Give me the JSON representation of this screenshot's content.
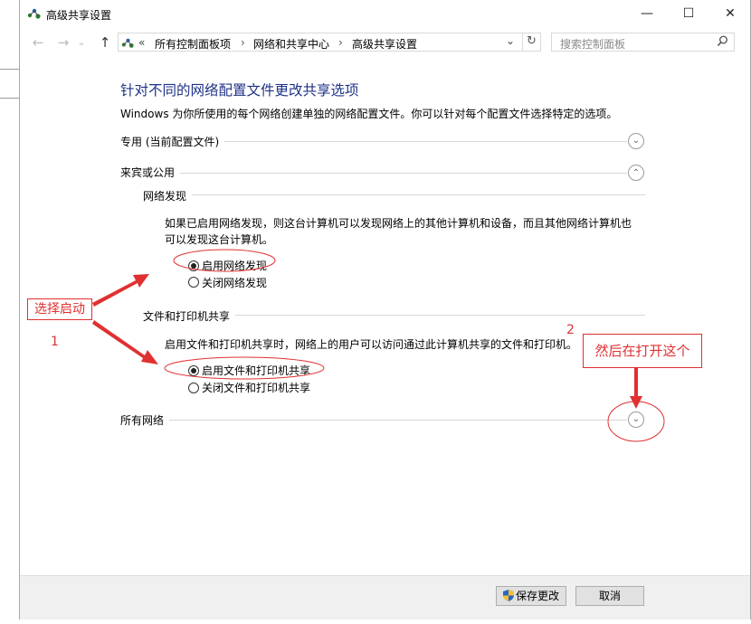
{
  "window": {
    "title": "高级共享设置",
    "minimize_glyph": "—",
    "maximize_glyph": "☐",
    "close_glyph": "✕"
  },
  "nav": {
    "back_glyph": "←",
    "forward_glyph": "→",
    "recent_glyph": "⌄",
    "up_glyph": "↑",
    "chevrons": "«",
    "breadcrumb": [
      "所有控制面板项",
      "网络和共享中心",
      "高级共享设置"
    ],
    "separator": "›",
    "dropdown_glyph": "⌄",
    "refresh_glyph": "↻",
    "search_placeholder": "搜索控制面板"
  },
  "main": {
    "heading": "针对不同的网络配置文件更改共享选项",
    "description": "Windows 为你所使用的每个网络创建单独的网络配置文件。你可以针对每个配置文件选择特定的选项。",
    "profiles": {
      "private": {
        "label": "专用 (当前配置文件)",
        "state": "collapsed"
      },
      "guest_public": {
        "label": "来宾或公用",
        "state": "expanded"
      },
      "all_networks": {
        "label": "所有网络",
        "state": "collapsed"
      }
    },
    "network_discovery": {
      "title": "网络发现",
      "description": "如果已启用网络发现，则这台计算机可以发现网络上的其他计算机和设备，而且其他网络计算机也可以发现这台计算机。",
      "options": [
        {
          "label": "启用网络发现",
          "checked": true
        },
        {
          "label": "关闭网络发现",
          "checked": false
        }
      ]
    },
    "file_printer_sharing": {
      "title": "文件和打印机共享",
      "description": "启用文件和打印机共享时，网络上的用户可以访问通过此计算机共享的文件和打印机。",
      "options": [
        {
          "label": "启用文件和打印机共享",
          "checked": true
        },
        {
          "label": "关闭文件和打印机共享",
          "checked": false
        }
      ]
    }
  },
  "footer": {
    "save_label": "保存更改",
    "cancel_label": "取消"
  },
  "annotations": {
    "step1_label": "选择启动",
    "step1_number": "1",
    "step2_label": "然后在打开这个",
    "step2_number": "2",
    "color": "#e03030"
  },
  "colors": {
    "heading": "#1e3287",
    "annotation": "#e03030",
    "footer_bg": "#f0f0f0"
  }
}
